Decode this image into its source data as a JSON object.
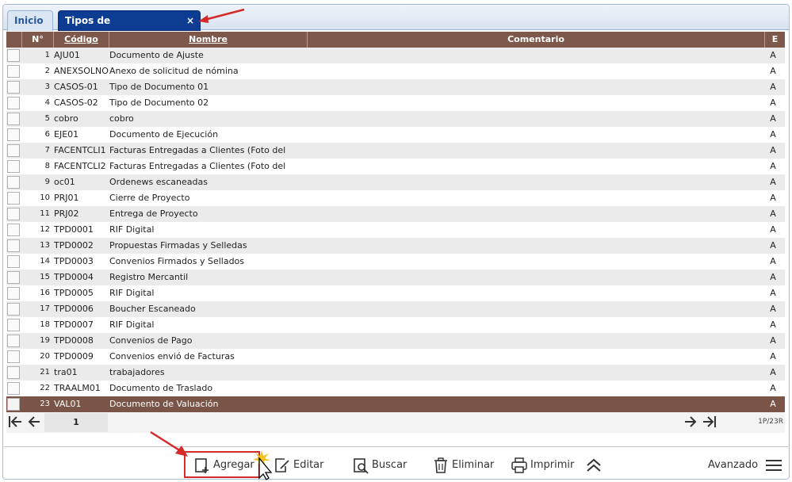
{
  "tabs": [
    {
      "label": "Inicio"
    },
    {
      "label": "Tipos de Documentación",
      "close": "×"
    }
  ],
  "columns": {
    "num": "N°",
    "codigo": "Código",
    "nombre": "Nombre",
    "comentario": "Comentario",
    "e": "E"
  },
  "rows": [
    {
      "n": "1",
      "codigo": "AJU01",
      "nombre": "Documento de Ajuste",
      "e": "A"
    },
    {
      "n": "2",
      "codigo": "ANEXSOLNOM",
      "nombre": "Anexo de solicitud de nómina",
      "e": "A"
    },
    {
      "n": "3",
      "codigo": "CASOS-01",
      "nombre": "Tipo de Documento 01",
      "e": "A"
    },
    {
      "n": "4",
      "codigo": "CASOS-02",
      "nombre": "Tipo de Documento 02",
      "e": "A"
    },
    {
      "n": "5",
      "codigo": "cobro",
      "nombre": "cobro",
      "e": "A"
    },
    {
      "n": "6",
      "codigo": "EJE01",
      "nombre": "Documento de Ejecución",
      "e": "A"
    },
    {
      "n": "7",
      "codigo": "FACENTCLI1",
      "nombre": "Facturas Entregadas a Clientes (Foto del",
      "e": "A"
    },
    {
      "n": "8",
      "codigo": "FACENTCLI2",
      "nombre": "Facturas Entregadas a Clientes (Foto del",
      "e": "A"
    },
    {
      "n": "9",
      "codigo": "oc01",
      "nombre": "Ordenews escaneadas",
      "e": "A"
    },
    {
      "n": "10",
      "codigo": "PRJ01",
      "nombre": "Cierre de Proyecto",
      "e": "A"
    },
    {
      "n": "11",
      "codigo": "PRJ02",
      "nombre": "Entrega de Proyecto",
      "e": "A"
    },
    {
      "n": "12",
      "codigo": "TPD0001",
      "nombre": "RIF Digital",
      "e": "A"
    },
    {
      "n": "13",
      "codigo": "TPD0002",
      "nombre": "Propuestas Firmadas y Selledas",
      "e": "A"
    },
    {
      "n": "14",
      "codigo": "TPD0003",
      "nombre": "Convenios Firmados y Sellados",
      "e": "A"
    },
    {
      "n": "15",
      "codigo": "TPD0004",
      "nombre": "Registro Mercantil",
      "e": "A"
    },
    {
      "n": "16",
      "codigo": "TPD0005",
      "nombre": "RIF Digital",
      "e": "A"
    },
    {
      "n": "17",
      "codigo": "TPD0006",
      "nombre": "Boucher Escaneado",
      "e": "A"
    },
    {
      "n": "18",
      "codigo": "TPD0007",
      "nombre": "RIF Digital",
      "e": "A"
    },
    {
      "n": "19",
      "codigo": "TPD0008",
      "nombre": "Convenios de Pago",
      "e": "A"
    },
    {
      "n": "20",
      "codigo": "TPD0009",
      "nombre": "Convenios envió de Facturas",
      "e": "A"
    },
    {
      "n": "21",
      "codigo": "tra01",
      "nombre": "trabajadores",
      "e": "A"
    },
    {
      "n": "22",
      "codigo": "TRAALM01",
      "nombre": "Documento de Traslado",
      "e": "A"
    },
    {
      "n": "23",
      "codigo": "VAL01",
      "nombre": "Documento de Valuación",
      "e": "A"
    }
  ],
  "pager": {
    "page": "1",
    "info": "1P/23R"
  },
  "toolbar": {
    "agregar": "Agregar",
    "editar": "Editar",
    "buscar": "Buscar",
    "eliminar": "Eliminar",
    "imprimir": "Imprimir",
    "avanzado": "Avanzado"
  },
  "colors": {
    "header": "#7d584b",
    "selected_row": "#7a5547",
    "active_tab": "#0d3d92",
    "annotation": "#d42a2a"
  }
}
